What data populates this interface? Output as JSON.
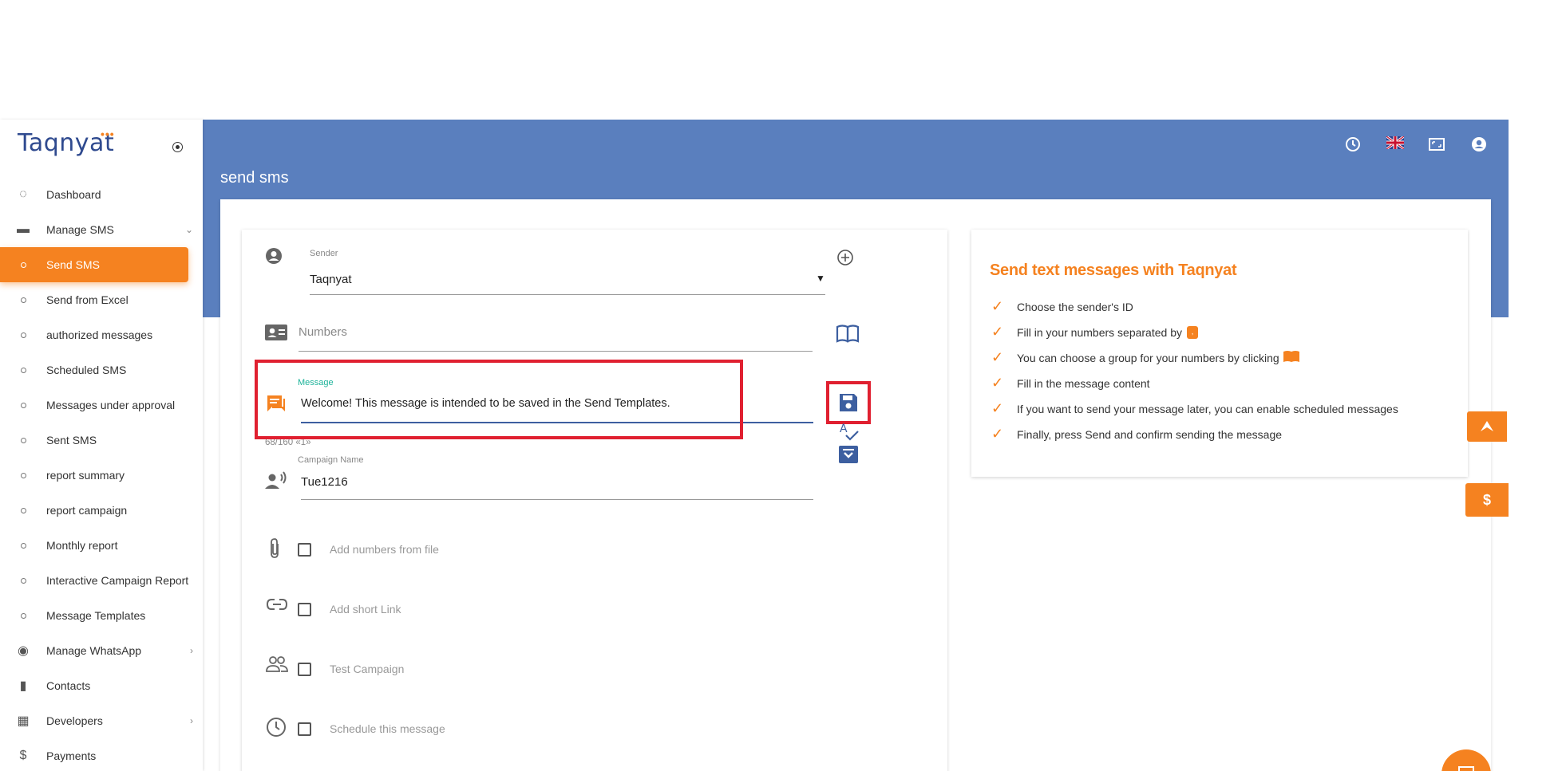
{
  "app": {
    "logo": "Taqnyat",
    "logo_dots": "•••"
  },
  "sidebar": {
    "items": [
      {
        "label": "Dashboard",
        "icon": "palette-icon"
      },
      {
        "label": "Manage SMS",
        "icon": "chat-icon",
        "chevron": "⌄"
      },
      {
        "label": "Send SMS",
        "active": true
      },
      {
        "label": "Send from Excel"
      },
      {
        "label": "authorized messages"
      },
      {
        "label": "Scheduled SMS"
      },
      {
        "label": "Messages under approval"
      },
      {
        "label": "Sent SMS"
      },
      {
        "label": "report summary"
      },
      {
        "label": "report campaign"
      },
      {
        "label": "Monthly report"
      },
      {
        "label": "Interactive Campaign Report"
      },
      {
        "label": "Message Templates"
      },
      {
        "label": "Manage WhatsApp",
        "icon": "whatsapp-icon",
        "chevron": "›"
      },
      {
        "label": "Contacts",
        "icon": "book-icon"
      },
      {
        "label": "Developers",
        "icon": "developer-icon",
        "chevron": "›"
      },
      {
        "label": "Payments",
        "icon": "dollar-icon"
      }
    ]
  },
  "header": {
    "title": "send sms"
  },
  "form": {
    "sender_label": "Sender",
    "sender_value": "Taqnyat",
    "numbers_placeholder": "Numbers",
    "message_label": "Message",
    "message_value": "Welcome! This message is intended to be saved in the Send Templates.",
    "char_count": "68/160 «1»",
    "campaign_label": "Campaign Name",
    "campaign_value": "Tue1216",
    "options": [
      "Add numbers from file",
      "Add short Link",
      "Test Campaign",
      "Schedule this message"
    ]
  },
  "info": {
    "title": "Send text messages with Taqnyat",
    "steps": [
      "Choose the sender's ID",
      "Fill in your numbers separated by",
      "You can choose a group for your numbers by clicking",
      "Fill in the message content",
      "If you want to send your message later, you can enable scheduled messages",
      "Finally, press Send and confirm sending the message"
    ]
  },
  "colors": {
    "accent": "#f58220",
    "header": "#5a7fbe",
    "brand": "#2f4a8f",
    "highlight": "#e02030"
  }
}
